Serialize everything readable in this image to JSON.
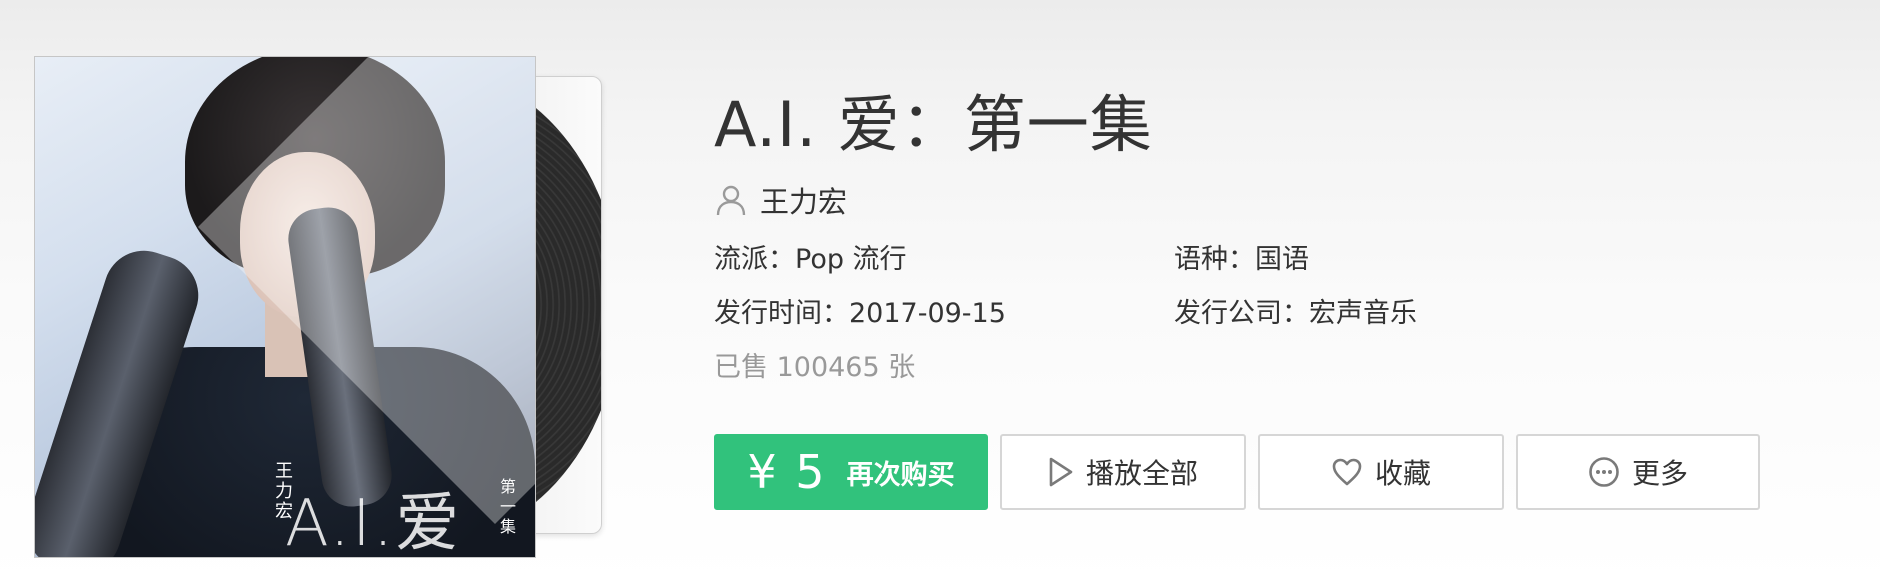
{
  "album": {
    "title": "A.I. 爱：第一集",
    "artist": "王力宏",
    "cover": {
      "title_text": "A.I.爱",
      "artist_text": "王力宏",
      "subtitle_text": "第一集"
    },
    "meta": {
      "genre": "流派：Pop 流行",
      "language": "语种：国语",
      "release_date": "发行时间：2017-09-15",
      "company": "发行公司：宏声音乐"
    },
    "sold": "已售 100465 张"
  },
  "actions": {
    "price": "¥ 5",
    "buy_label": "再次购买",
    "play_all": "播放全部",
    "favorite": "收藏",
    "more": "更多"
  },
  "icons": {
    "artist": "person-icon",
    "play": "play-icon",
    "favorite": "heart-icon",
    "more": "more-icon"
  },
  "colors": {
    "accent": "#31c27c",
    "muted_text": "#999999",
    "text": "#333333"
  }
}
